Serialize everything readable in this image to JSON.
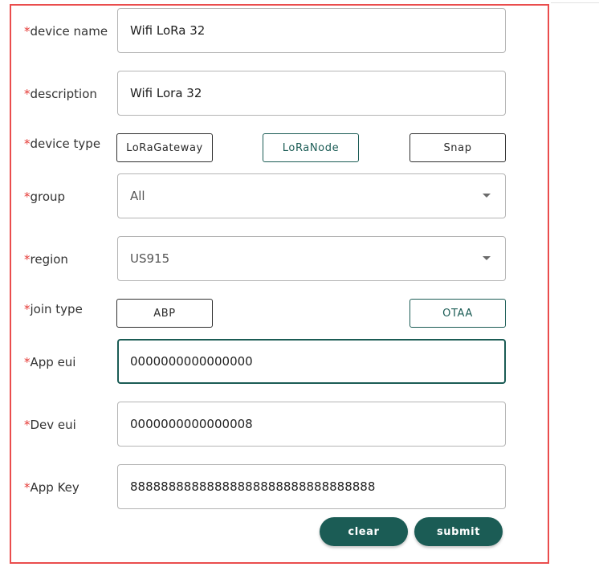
{
  "form": {
    "required_marker": "*",
    "device_name": {
      "label": "device name",
      "value": "Wifi LoRa 32"
    },
    "description": {
      "label": "description",
      "value": "Wifi Lora 32"
    },
    "device_type": {
      "label": "device type",
      "options": [
        "LoRaGateway",
        "LoRaNode",
        "Snap"
      ],
      "selected": "LoRaNode"
    },
    "group": {
      "label": "group",
      "value": "All"
    },
    "region": {
      "label": "region",
      "value": "US915"
    },
    "join_type": {
      "label": "join type",
      "options": [
        "ABP",
        "OTAA"
      ],
      "selected": "OTAA"
    },
    "app_eui": {
      "label": "App eui",
      "value": "0000000000000000"
    },
    "dev_eui": {
      "label": "Dev eui",
      "value": "0000000000000008"
    },
    "app_key": {
      "label": "App Key",
      "value": "88888888888888888888888888888888"
    },
    "buttons": {
      "clear": "clear",
      "submit": "submit"
    }
  },
  "colors": {
    "frame_border": "#ea4d4d",
    "required": "#e53935",
    "accent": "#1b5c55"
  }
}
